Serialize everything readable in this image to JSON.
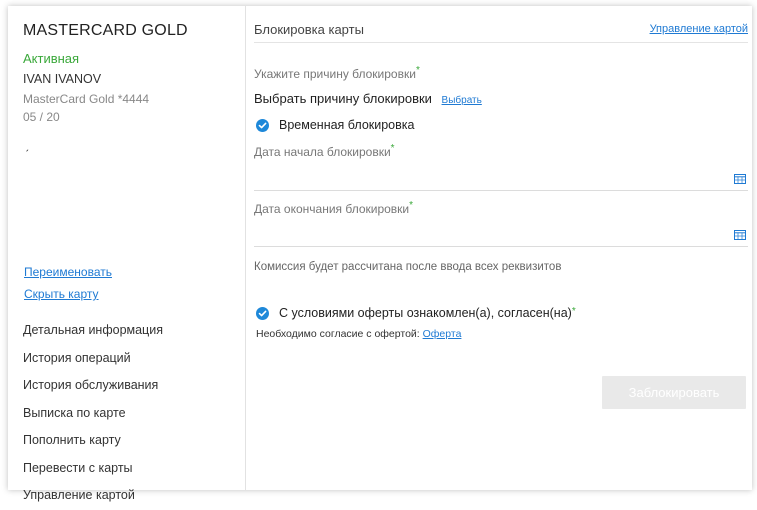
{
  "sidebar": {
    "card_title": "MASTERCARD GOLD",
    "status": "Активная",
    "owner": "IVAN IVANOV",
    "card_number": "MasterCard Gold *4444",
    "expiry": "05 / 20",
    "mark": "ˏ",
    "rename_link": "Переименовать",
    "hide_link": "Скрыть карту",
    "nav": [
      {
        "label": "Детальная информация"
      },
      {
        "label": "История операций"
      },
      {
        "label": "История обслуживания"
      },
      {
        "label": "Выписка по карте"
      },
      {
        "label": "Пополнить карту"
      },
      {
        "label": "Перевести с карты"
      },
      {
        "label": "Управление картой"
      }
    ]
  },
  "main": {
    "title": "Блокировка карты",
    "manage_link": "Управление картой",
    "reason_label": "Укажите причину блокировки",
    "reason_value": "Выбрать причину блокировки",
    "reason_choose": "Выбрать",
    "temporary_label": "Временная блокировка",
    "start_date_label": "Дата начала блокировки",
    "end_date_label": "Дата окончания блокировки",
    "required_mark": "*",
    "commission_note": "Комиссия будет рассчитана после ввода всех реквизитов",
    "consent_label": "С условиями оферты ознакомлен(а), согласен(на)",
    "consent_note": "Необходимо согласие с офертой:",
    "offer_link": "Оферта",
    "submit_label": "Заблокировать"
  },
  "colors": {
    "accent": "#1f7ad3",
    "active_status": "#3aa83a",
    "checkbox": "#1e88d9",
    "disabled_button": "#e9e9e9"
  },
  "icons": {
    "check": "check-icon",
    "calendar": "calendar-icon"
  }
}
